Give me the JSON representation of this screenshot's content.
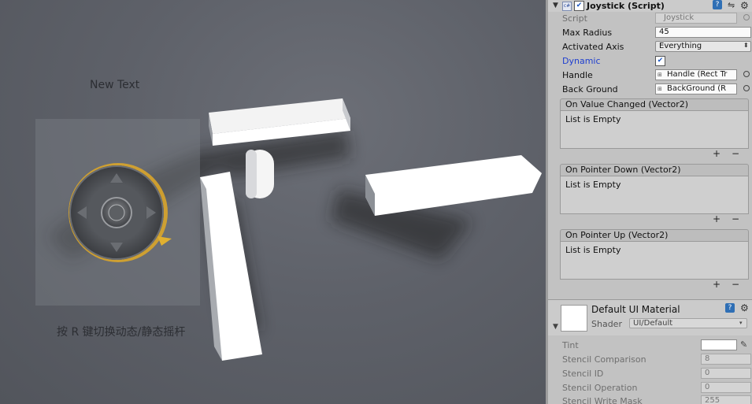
{
  "scene": {
    "new_text": "New Text",
    "hint_text": "按 R 键切换动态/静态摇杆"
  },
  "inspector": {
    "component_title": "Joystick (Script)",
    "properties": [
      {
        "label": "Script",
        "value": "Joystick"
      },
      {
        "label": "Max Radius",
        "value": "45"
      },
      {
        "label": "Activated Axis",
        "value": "Everything"
      },
      {
        "label": "Dynamic",
        "value": "checked"
      },
      {
        "label": "Handle",
        "value": "Handle (Rect Tr"
      },
      {
        "label": "Back Ground",
        "value": "BackGround (R"
      }
    ],
    "events": [
      {
        "title": "On Value Changed (Vector2)",
        "body": "List is Empty"
      },
      {
        "title": "On Pointer Down (Vector2)",
        "body": "List is Empty"
      },
      {
        "title": "On Pointer Up (Vector2)",
        "body": "List is Empty"
      }
    ],
    "plus_label": "+",
    "minus_label": "−",
    "material": {
      "name": "Default UI Material",
      "shader_label": "Shader",
      "shader_value": "UI/Default"
    },
    "material_properties": [
      {
        "label": "Tint",
        "value": ""
      },
      {
        "label": "Stencil Comparison",
        "value": "8"
      },
      {
        "label": "Stencil ID",
        "value": "0"
      },
      {
        "label": "Stencil Operation",
        "value": "0"
      },
      {
        "label": "Stencil Write Mask",
        "value": "255"
      }
    ]
  }
}
